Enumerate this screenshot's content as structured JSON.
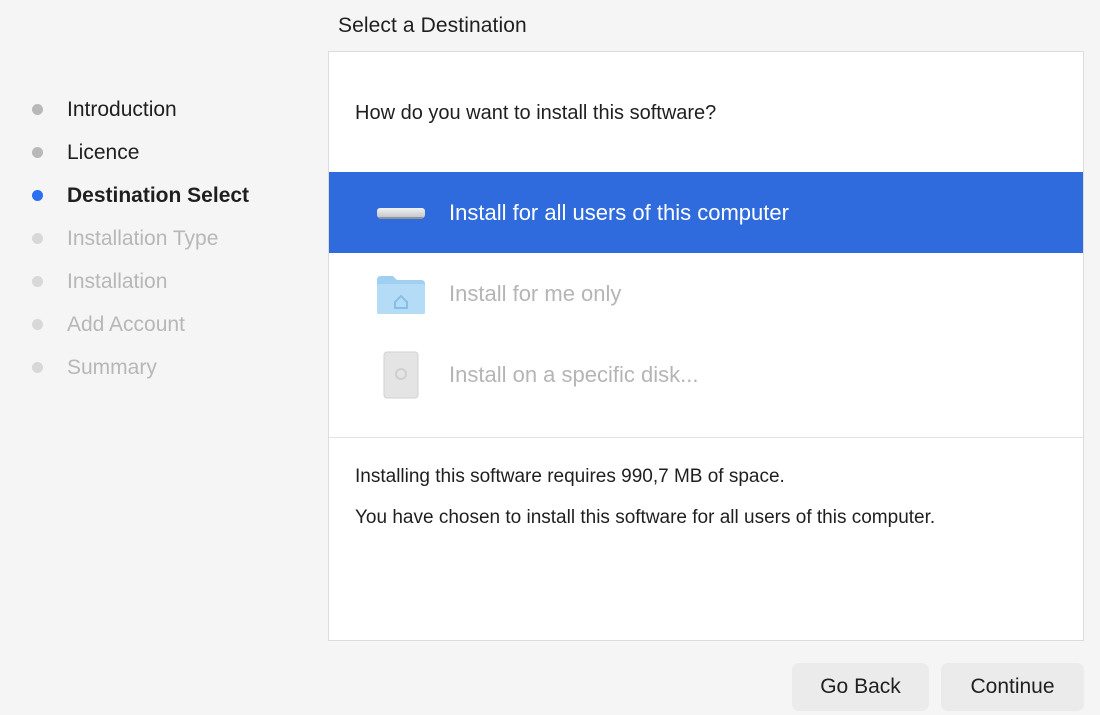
{
  "header": {
    "title": "Select a Destination"
  },
  "sidebar": {
    "steps": [
      {
        "label": "Introduction",
        "state": "done"
      },
      {
        "label": "Licence",
        "state": "done"
      },
      {
        "label": "Destination Select",
        "state": "current"
      },
      {
        "label": "Installation Type",
        "state": "pending"
      },
      {
        "label": "Installation",
        "state": "pending"
      },
      {
        "label": "Add Account",
        "state": "pending"
      },
      {
        "label": "Summary",
        "state": "pending"
      }
    ]
  },
  "main": {
    "question": "How do you want to install this software?",
    "options": [
      {
        "label": "Install for all users of this computer",
        "icon": "computer-icon",
        "selected": true
      },
      {
        "label": "Install for me only",
        "icon": "home-folder-icon",
        "selected": false
      },
      {
        "label": "Install on a specific disk...",
        "icon": "disk-icon",
        "selected": false
      }
    ],
    "space_required": "Installing this software requires 990,7 MB of space.",
    "choice_summary": "You have chosen to install this software for all users of this computer."
  },
  "footer": {
    "back_label": "Go Back",
    "continue_label": "Continue"
  },
  "colors": {
    "accent": "#2f6bdc",
    "current_step_dot": "#2a6ff0"
  }
}
